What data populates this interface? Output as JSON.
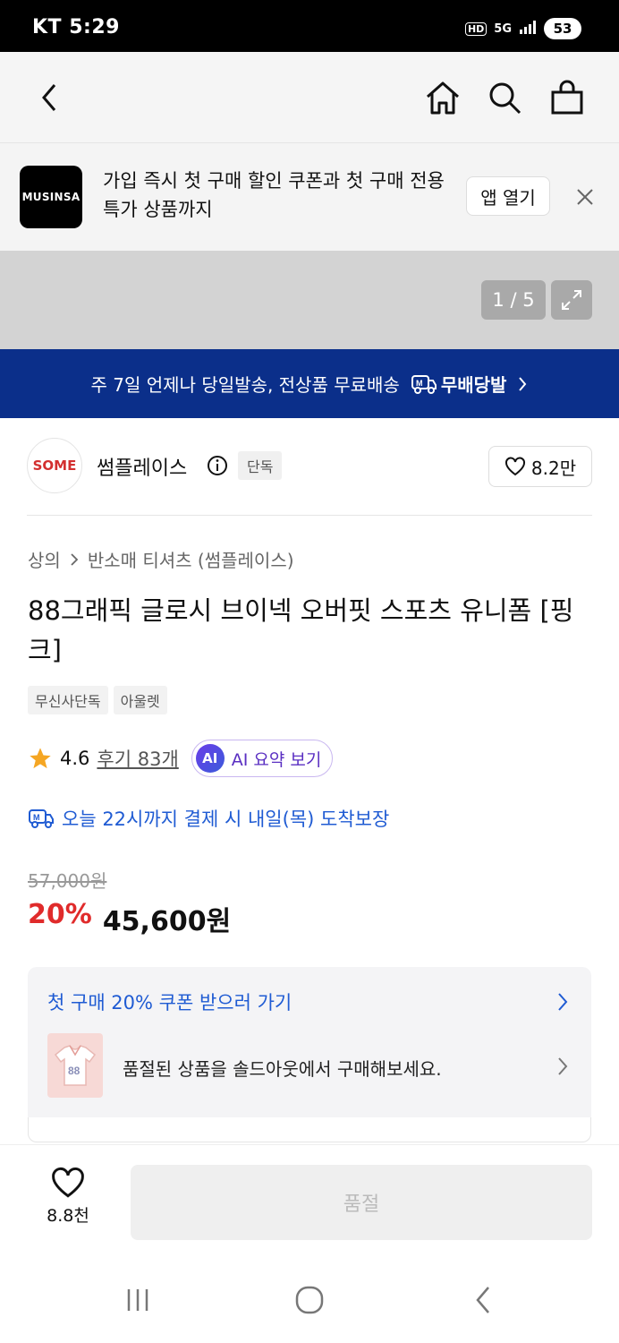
{
  "status_bar": {
    "carrier_time": "KT 5:29",
    "network": "5G",
    "battery": "53"
  },
  "banner": {
    "logo_text": "MUSINSA",
    "message": "가입 즉시 첫 구매 할인 쿠폰과 첫 구매 전용 특가 상품까지",
    "open_app_label": "앱 열기"
  },
  "gallery": {
    "counter": "1 / 5"
  },
  "shipping_bar": {
    "text": "주 7일 언제나 당일발송, 전상품 무료배송",
    "brand": "무배당발"
  },
  "brand": {
    "logo_text": "SOME",
    "name": "썸플레이스",
    "exclusive_badge": "단독",
    "likes": "8.2만"
  },
  "breadcrumb": {
    "category": "상의",
    "subcategory": "반소매 티셔츠 (썸플레이스)"
  },
  "product": {
    "title": "88그래픽 글로시 브이넥 오버핏 스포츠 유니폼 [핑크]",
    "tags": [
      "무신사단독",
      "아울렛"
    ],
    "rating": "4.6",
    "reviews": "후기 83개",
    "ai_button": "AI 요약 보기",
    "ai_badge": "AI",
    "delivery_text": "오늘 22시까지 결제 시 내일(목) 도착보장",
    "original_price": "57,000원",
    "discount": "20%",
    "sale_price": "45,600원"
  },
  "coupon": {
    "link_text": "첫 구매 20% 쿠폰 받으러 가기",
    "soldout_text": "품절된 상품을 솔드아웃에서 구매해보세요.",
    "thumb_text": "88"
  },
  "bottom_bar": {
    "wish_count": "8.8천",
    "soldout_label": "품절"
  },
  "colors": {
    "navy": "#0b2f8a",
    "blue_text": "#1f5bd3",
    "discount_red": "#e02b2b",
    "star": "#f5a623"
  }
}
